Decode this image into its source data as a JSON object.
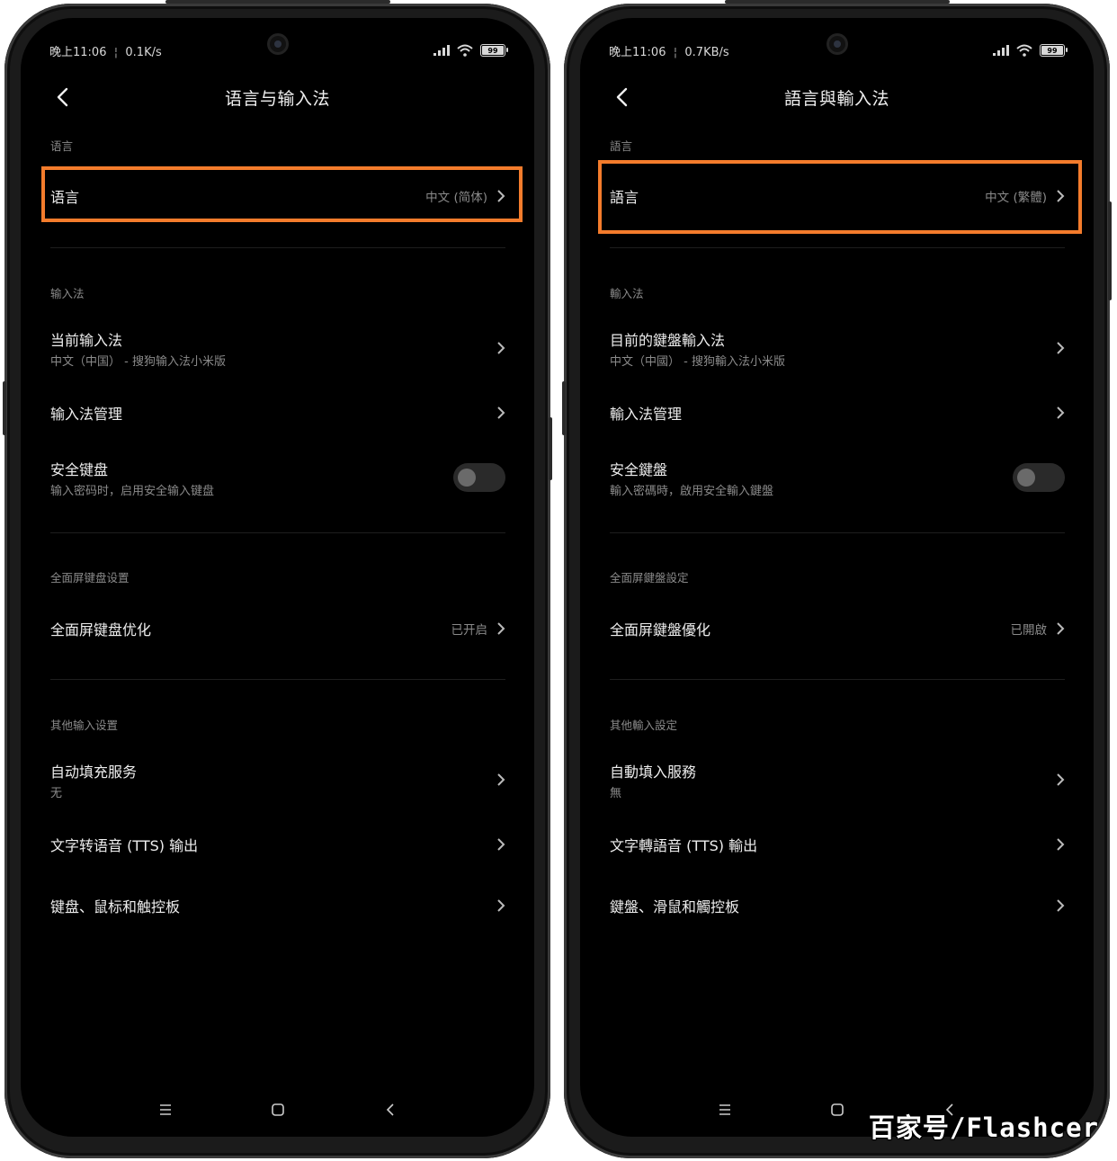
{
  "phones": [
    {
      "status": {
        "time": "晚上11:06",
        "speed": "0.1K/s",
        "battery": "99"
      },
      "title": "语言与输入法",
      "section_language": "语言",
      "language_item": {
        "label": "语言",
        "value": "中文 (简体)"
      },
      "section_input": "输入法",
      "current_ime": {
        "label": "当前输入法",
        "sub": "中文（中国） - 搜狗输入法小米版"
      },
      "ime_manage": {
        "label": "输入法管理"
      },
      "secure_keyboard": {
        "label": "安全键盘",
        "sub": "输入密码时，启用安全输入键盘"
      },
      "section_fullscreen": "全面屏键盘设置",
      "fullscreen_opt": {
        "label": "全面屏键盘优化",
        "value": "已开启"
      },
      "section_other": "其他输入设置",
      "autofill": {
        "label": "自动填充服务",
        "sub": "无"
      },
      "tts": {
        "label": "文字转语音 (TTS) 输出"
      },
      "kb_mouse": {
        "label": "键盘、鼠标和触控板"
      }
    },
    {
      "status": {
        "time": "晚上11:06",
        "speed": "0.7KB/s",
        "battery": "99"
      },
      "title": "語言與輸入法",
      "section_language": "語言",
      "language_item": {
        "label": "語言",
        "value": "中文 (繁體)"
      },
      "section_input": "輸入法",
      "current_ime": {
        "label": "目前的鍵盤輸入法",
        "sub": "中文（中國） - 搜狗輸入法小米版"
      },
      "ime_manage": {
        "label": "輸入法管理"
      },
      "secure_keyboard": {
        "label": "安全鍵盤",
        "sub": "輸入密碼時，啟用安全輸入鍵盤"
      },
      "section_fullscreen": "全面屏鍵盤設定",
      "fullscreen_opt": {
        "label": "全面屏鍵盤優化",
        "value": "已開啟"
      },
      "section_other": "其他輸入設定",
      "autofill": {
        "label": "自動填入服務",
        "sub": "無"
      },
      "tts": {
        "label": "文字轉語音 (TTS) 輸出"
      },
      "kb_mouse": {
        "label": "鍵盤、滑鼠和觸控板"
      }
    }
  ],
  "watermark": "百家号/Flashcer",
  "colors": {
    "highlight": "#f47c2c",
    "background": "#000000",
    "text": "#eeeeee",
    "subtext": "#8a8a8a"
  },
  "icons": [
    "back-arrow-icon",
    "chevron-right-icon",
    "signal-icon",
    "wifi-icon",
    "battery-icon",
    "menu-icon",
    "home-icon",
    "back-nav-icon"
  ]
}
